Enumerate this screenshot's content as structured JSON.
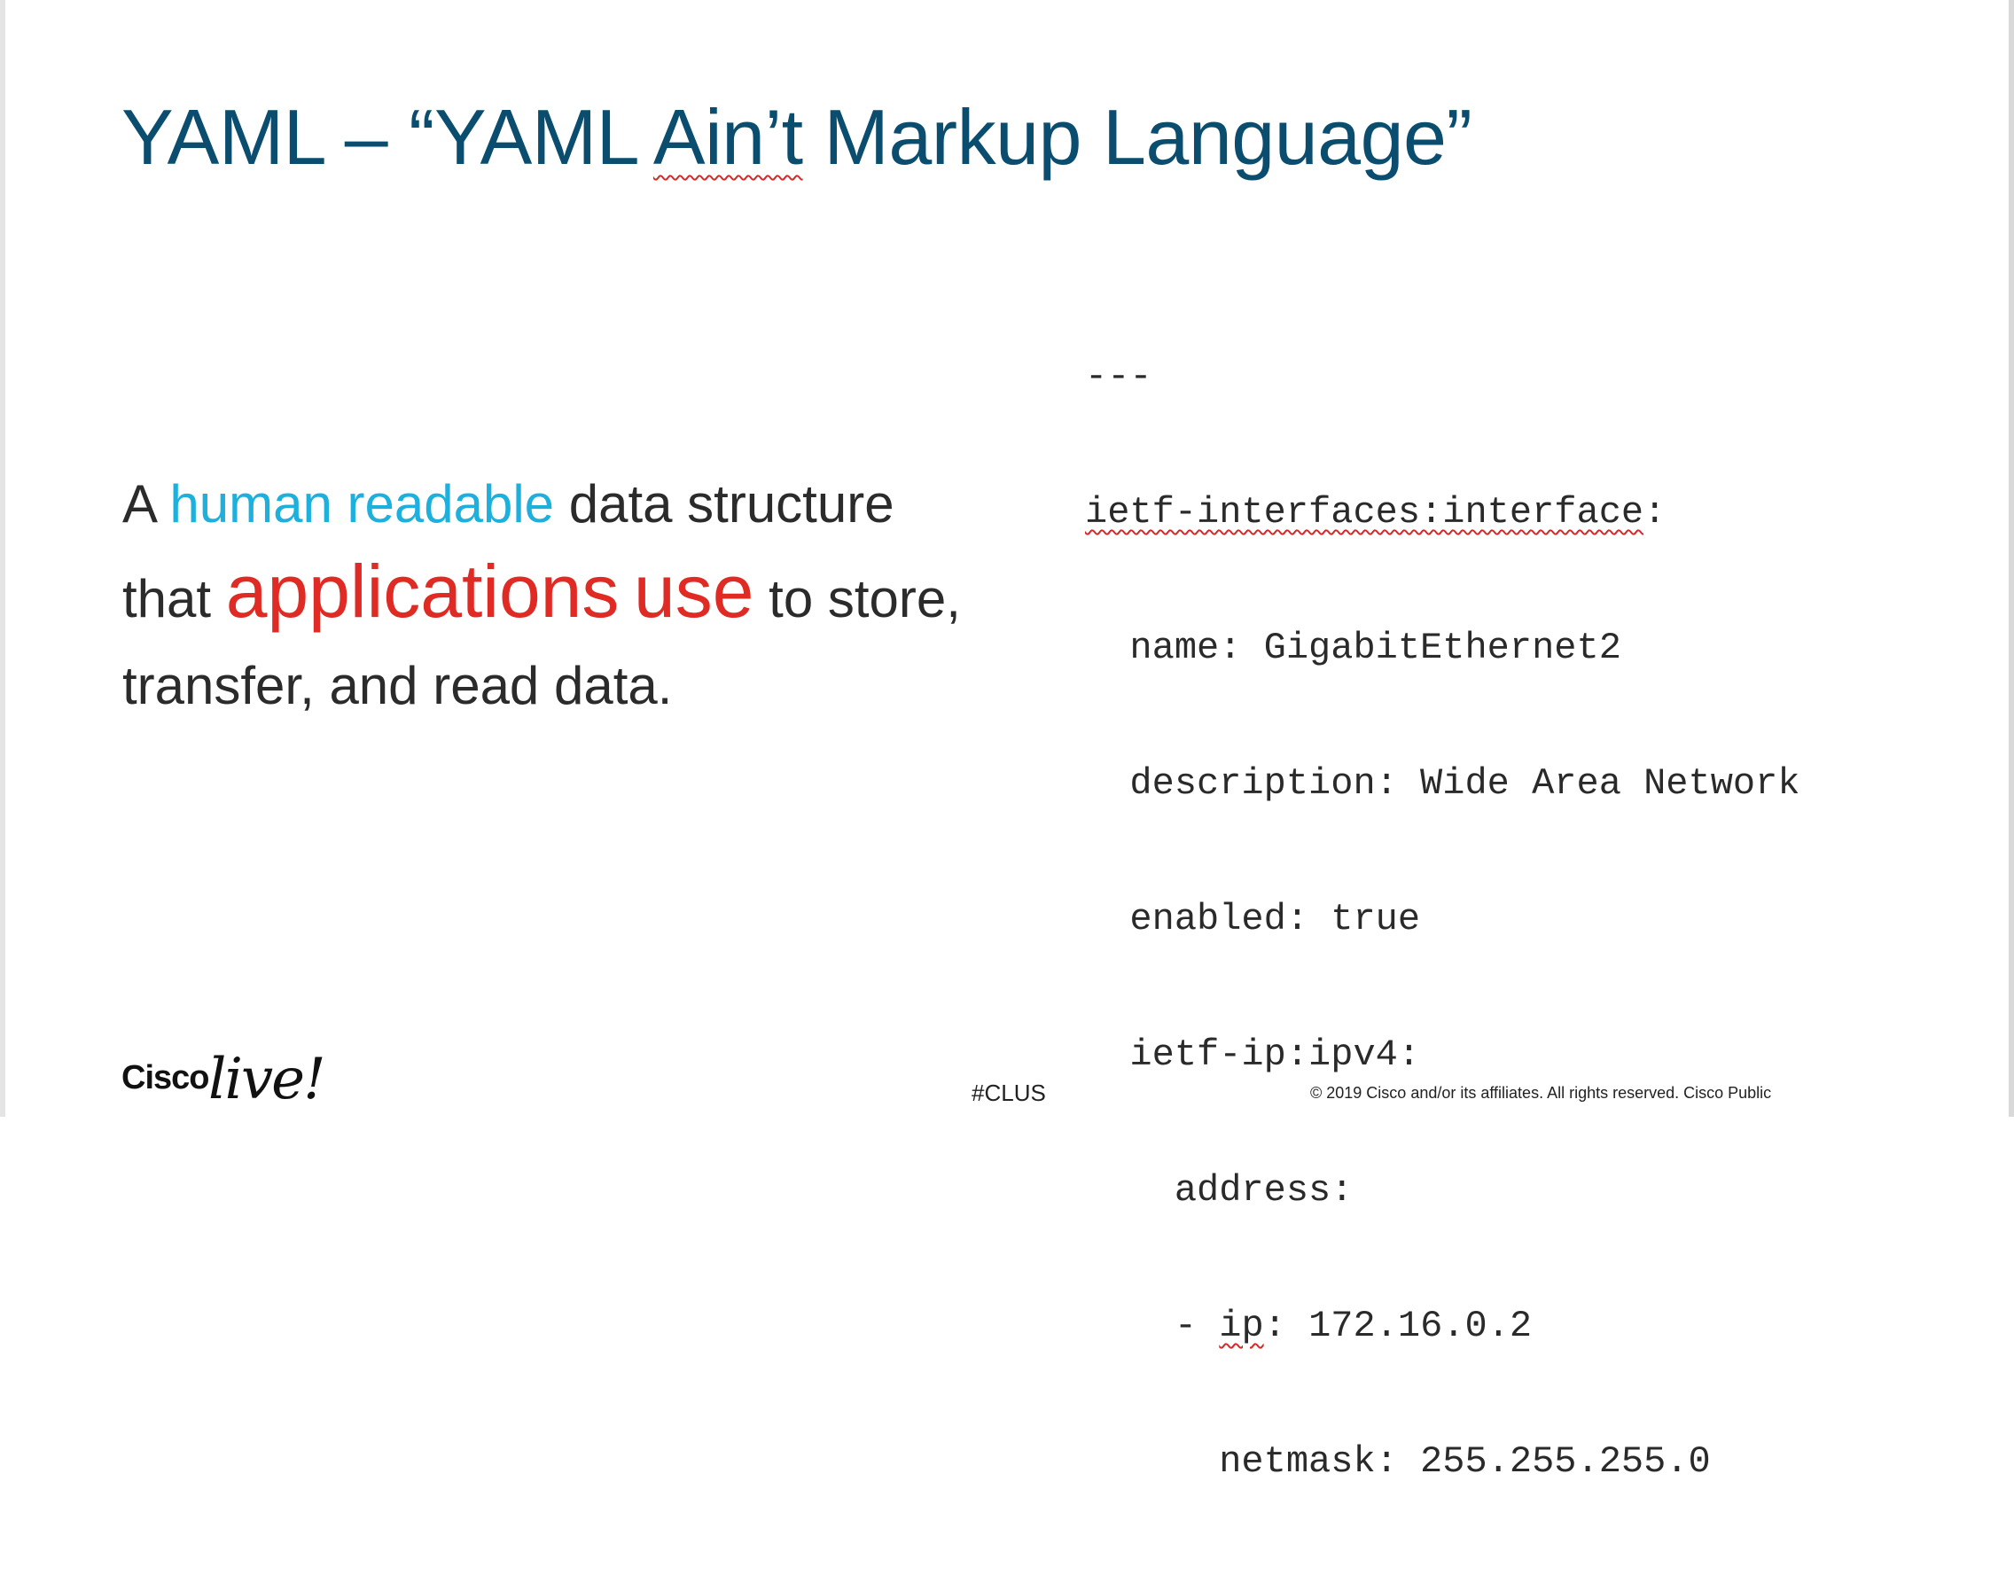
{
  "title": {
    "prefix": "YAML – “YAML ",
    "word": "Ain’t",
    "suffix": " Markup Language”"
  },
  "body": {
    "t1": "A ",
    "blue": "human readable",
    "t2": " data structure that ",
    "red1": "applications",
    "t3": " ",
    "red2": "use",
    "t4": " to store, transfer, and read data."
  },
  "code": {
    "l1": "---",
    "l2_word": "ietf-interfaces:interface",
    "l2_rest": ":",
    "l3": "  name: GigabitEthernet2",
    "l4": "  description: Wide Area Network",
    "l5": "  enabled: true",
    "l6": "  ietf-ip:ipv4:",
    "l7": "    address:",
    "l8_pre": "    - ",
    "l8_word": "ip",
    "l8_rest": ": 172.16.0.2",
    "l9": "      netmask: 255.255.255.0"
  },
  "footer": {
    "logo_cisco": "Cisco",
    "logo_live": "live!",
    "hashtag": "#CLUS",
    "copyright": "© 2019  Cisco and/or its affiliates. All rights reserved.   Cisco Public"
  },
  "colors": {
    "title": "#0a4d6e",
    "highlight_blue": "#1eb0dc",
    "highlight_red": "#e02a24",
    "text": "#2b2b2b"
  }
}
